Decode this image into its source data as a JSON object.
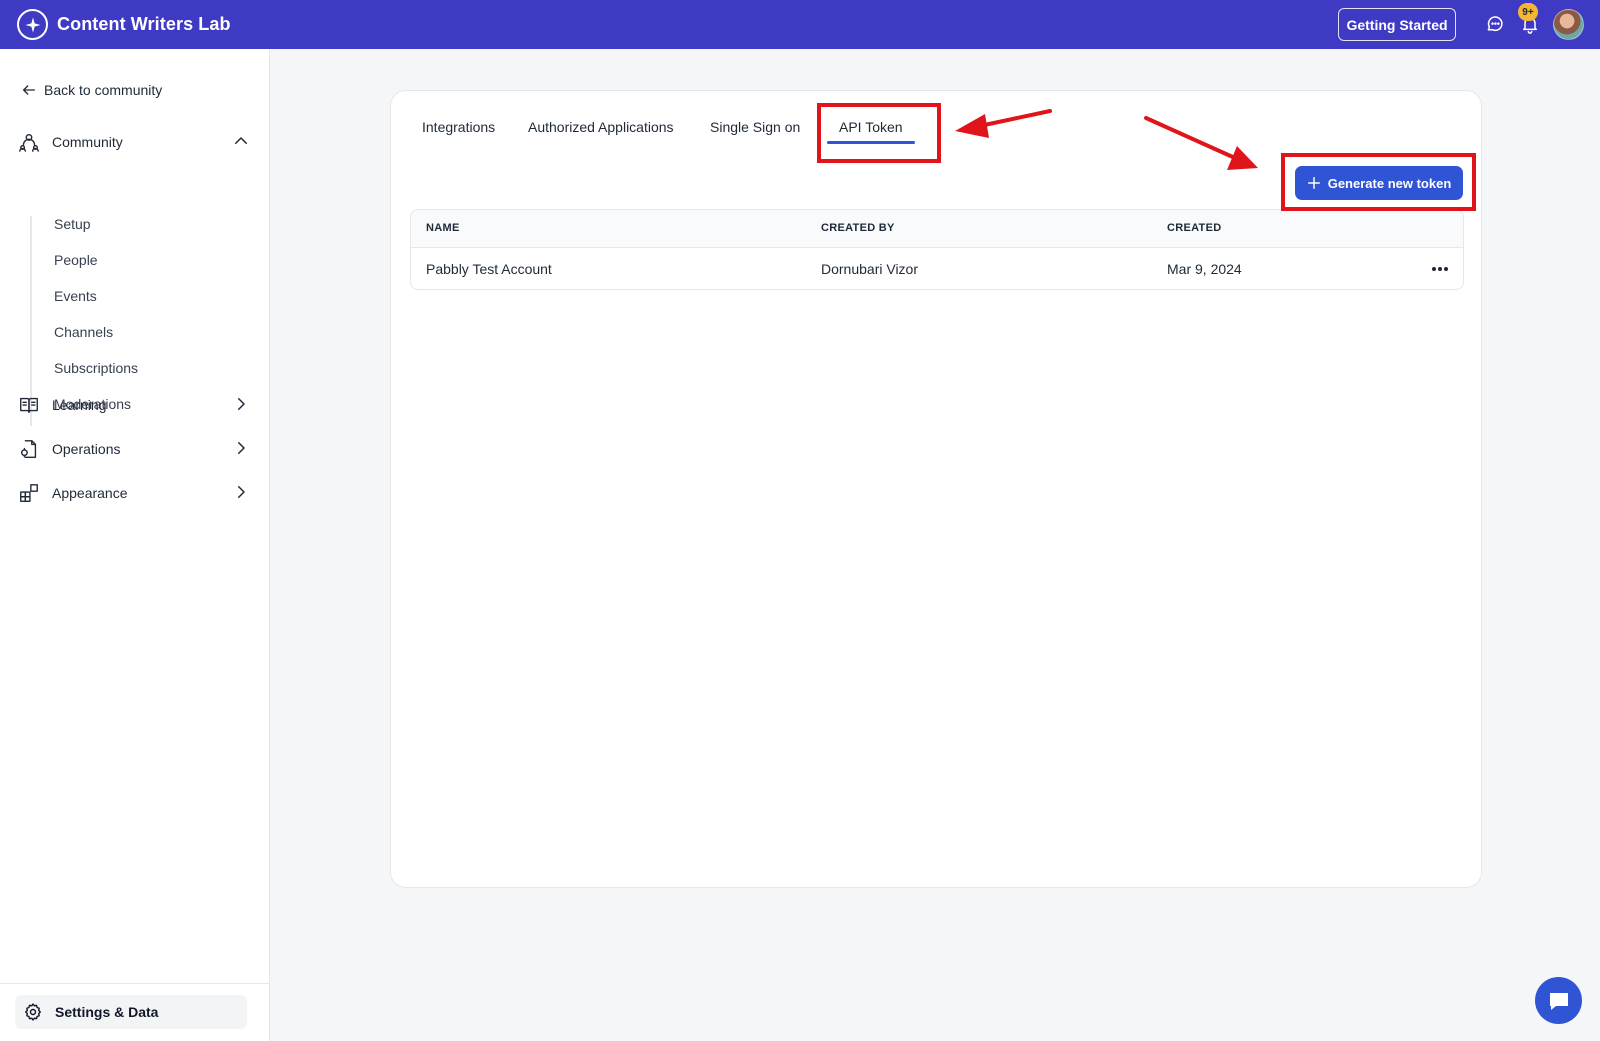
{
  "app": {
    "name": "Content Writers Lab",
    "brand_color": "#3f3ac4",
    "accent_color": "#2f55d4"
  },
  "topbar": {
    "getting_started_label": "Getting Started",
    "notification_badge": "9+",
    "icons": [
      "chat-icon",
      "bell-icon",
      "user-avatar"
    ]
  },
  "sidebar": {
    "back_label": "Back to community",
    "sections": [
      {
        "label": "Community",
        "icon": "community-icon",
        "expanded": true,
        "items": [
          "Setup",
          "People",
          "Events",
          "Channels",
          "Subscriptions",
          "Moderations"
        ]
      },
      {
        "label": "Learning",
        "icon": "book-icon",
        "expanded": false
      },
      {
        "label": "Operations",
        "icon": "operations-icon",
        "expanded": false
      },
      {
        "label": "Appearance",
        "icon": "appearance-icon",
        "expanded": false
      }
    ],
    "footer_label": "Settings & Data"
  },
  "main": {
    "tabs": [
      {
        "label": "Integrations",
        "active": false
      },
      {
        "label": "Authorized Applications",
        "active": false
      },
      {
        "label": "Single Sign on",
        "active": false
      },
      {
        "label": "API Token",
        "active": true
      }
    ],
    "generate_button_label": "Generate new token",
    "table": {
      "columns": [
        "NAME",
        "CREATED BY",
        "CREATED"
      ],
      "rows": [
        {
          "name": "Pabbly Test Account",
          "created_by": "Dornubari Vizor",
          "created": "Mar 9, 2024"
        }
      ]
    }
  },
  "annotations": {
    "color": "#e0141b",
    "highlighted": [
      "API Token tab",
      "Generate new token button"
    ]
  }
}
